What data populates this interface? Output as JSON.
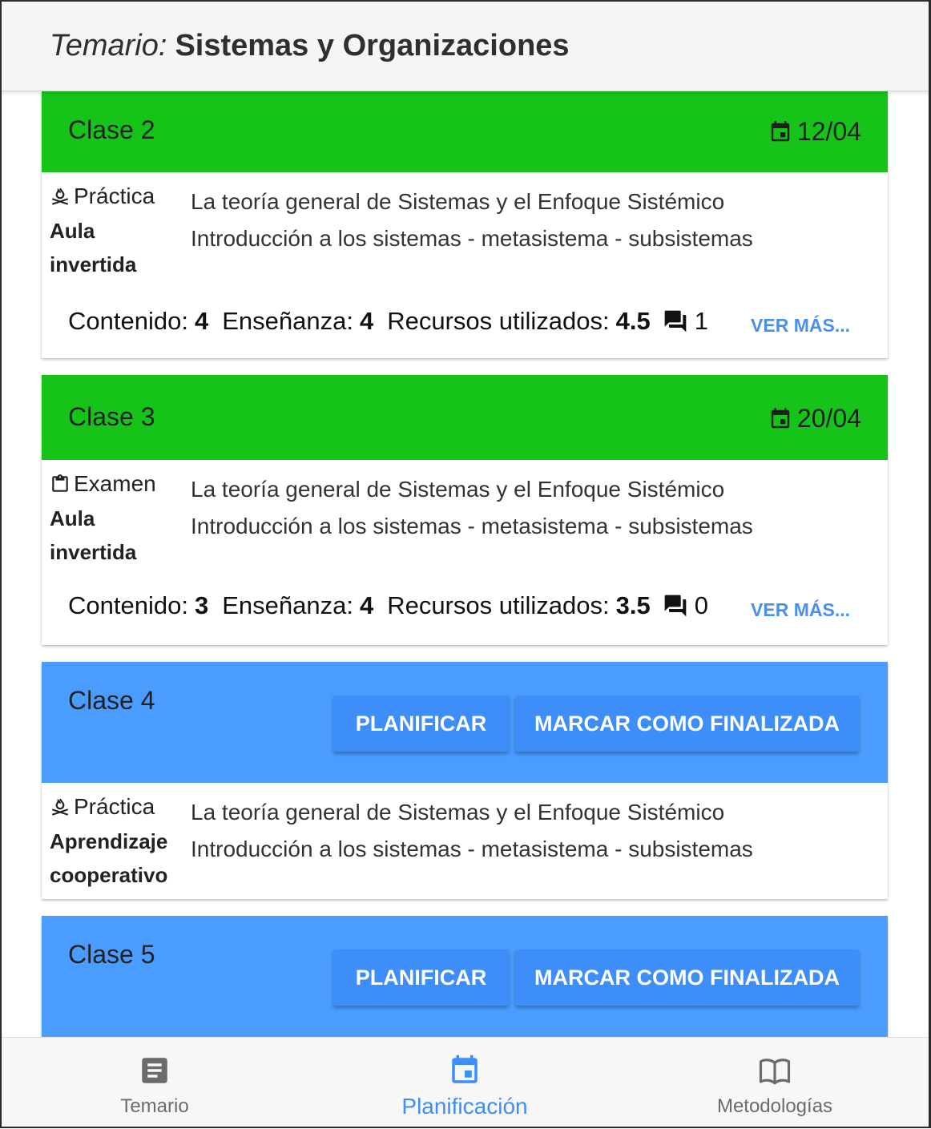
{
  "header": {
    "prefix": "Temario:",
    "title": "Sistemas y Organizaciones"
  },
  "colors": {
    "done": "#16c419",
    "pending": "#4a9cfe",
    "button": "#3d8ef8",
    "accent": "#3d8ef8"
  },
  "classes": [
    {
      "title": "Clase 2",
      "status": "done",
      "date": "12/04",
      "date_icon": "event-calendar-icon",
      "type": "Práctica",
      "type_icon": "campfire-icon",
      "methodology": "Aula invertida",
      "topics": [
        "La teoría general de Sistemas y el Enfoque Sistémico",
        "Introducción a los sistemas - metasistema - subsistemas"
      ],
      "ratings": {
        "contenido_label": "Contenido:",
        "contenido": "4",
        "ensenanza_label": "Enseñanza:",
        "ensenanza": "4",
        "recursos_label": "Recursos utilizados:",
        "recursos": "4.5",
        "comments": "1",
        "comments_icon": "forum-icon"
      },
      "more_label": "VER MÁS..."
    },
    {
      "title": "Clase 3",
      "status": "done",
      "date": "20/04",
      "date_icon": "event-calendar-icon",
      "type": "Examen",
      "type_icon": "clipboard-icon",
      "methodology": "Aula invertida",
      "topics": [
        "La teoría general de Sistemas y el Enfoque Sistémico",
        "Introducción a los sistemas - metasistema - subsistemas"
      ],
      "ratings": {
        "contenido_label": "Contenido:",
        "contenido": "3",
        "ensenanza_label": "Enseñanza:",
        "ensenanza": "4",
        "recursos_label": "Recursos utilizados:",
        "recursos": "3.5",
        "comments": "0",
        "comments_icon": "forum-icon"
      },
      "more_label": "VER MÁS..."
    },
    {
      "title": "Clase 4",
      "status": "pending",
      "plan_label": "PLANIFICAR",
      "finish_label": "MARCAR COMO FINALIZADA",
      "type": "Práctica",
      "type_icon": "campfire-icon",
      "methodology": "Aprendizaje cooperativo",
      "topics": [
        "La teoría general de Sistemas y el Enfoque Sistémico",
        "Introducción a los sistemas - metasistema - subsistemas"
      ]
    },
    {
      "title": "Clase 5",
      "status": "pending",
      "plan_label": "PLANIFICAR",
      "finish_label": "MARCAR COMO FINALIZADA"
    }
  ],
  "nav": [
    {
      "label": "Temario",
      "icon": "document-icon",
      "active": false
    },
    {
      "label": "Planificación",
      "icon": "calendar-icon",
      "active": true
    },
    {
      "label": "Metodologías",
      "icon": "book-icon",
      "active": false
    }
  ]
}
